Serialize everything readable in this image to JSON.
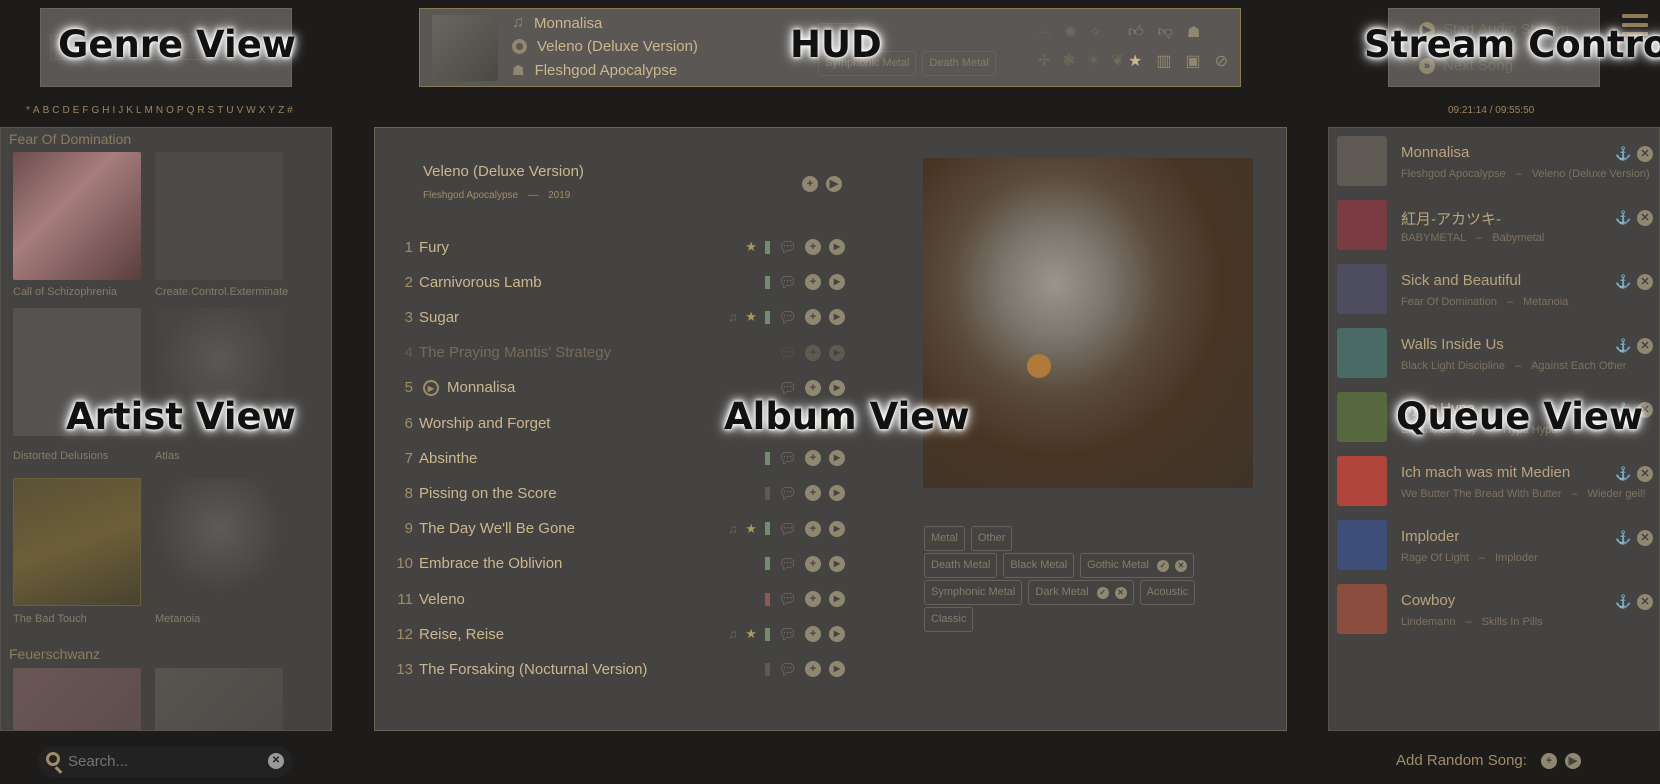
{
  "overlay_labels": {
    "genre": "Genre View",
    "hud": "HUD",
    "stream": "Stream Control",
    "artist": "Artist View",
    "album": "Album View",
    "queue": "Queue View"
  },
  "alphabet": [
    "*",
    "A",
    "B",
    "C",
    "D",
    "E",
    "F",
    "G",
    "H",
    "I",
    "J",
    "K",
    "L",
    "M",
    "N",
    "O",
    "P",
    "Q",
    "R",
    "S",
    "T",
    "U",
    "V",
    "W",
    "X",
    "Y",
    "Z",
    "#"
  ],
  "hud": {
    "song": "Monnalisa",
    "album": "Veleno (Deluxe Version)",
    "artist": "Fleshgod Apocalypse",
    "tags": [
      "Symphonic Metal",
      "Death Metal"
    ],
    "song_icon": "music-note-icon",
    "album_icon": "disc-icon",
    "artist_icon": "people-icon"
  },
  "stream": {
    "start": "Start Audio Stream",
    "next": "Next Song",
    "time": "09:21:14 / 09:55:50"
  },
  "artist_view": {
    "groups": [
      {
        "name": "Fear Of Domination"
      },
      {
        "name": "Feuerschwanz"
      }
    ],
    "albums": [
      {
        "name": "Call of Schizophrenia"
      },
      {
        "name": "Create.Control.Exterminate"
      },
      {
        "name": "Distorted Delusions"
      },
      {
        "name": "Atlas"
      },
      {
        "name": "The Bad Touch"
      },
      {
        "name": "Metanoia"
      }
    ]
  },
  "album_view": {
    "title": "Veleno (Deluxe Version)",
    "artist": "Fleshgod Apocalypse",
    "separator": "—",
    "year": "2019",
    "tracks": [
      {
        "n": "1",
        "t": "Fury",
        "lyrics": false,
        "fav": true,
        "bar": "#6f8f6a",
        "disabled": false
      },
      {
        "n": "2",
        "t": "Carnivorous Lamb",
        "lyrics": false,
        "fav": false,
        "bar": "#6f8f6a",
        "disabled": false
      },
      {
        "n": "3",
        "t": "Sugar",
        "lyrics": true,
        "fav": true,
        "bar": "#6f8f6a",
        "disabled": false
      },
      {
        "n": "4",
        "t": "The Praying Mantis' Strategy",
        "lyrics": false,
        "fav": false,
        "bar": "",
        "disabled": true
      },
      {
        "n": "5",
        "t": "Monnalisa",
        "lyrics": false,
        "fav": false,
        "bar": "",
        "disabled": false,
        "playing": true
      },
      {
        "n": "6",
        "t": "Worship and Forget",
        "lyrics": false,
        "fav": false,
        "bar": "#5f5a50",
        "disabled": false
      },
      {
        "n": "7",
        "t": "Absinthe",
        "lyrics": false,
        "fav": false,
        "bar": "#6f8f6a",
        "disabled": false
      },
      {
        "n": "8",
        "t": "Pissing on the Score",
        "lyrics": false,
        "fav": false,
        "bar": "#5f5a50",
        "disabled": false
      },
      {
        "n": "9",
        "t": "The Day We'll Be Gone",
        "lyrics": true,
        "fav": true,
        "bar": "#6f8f6a",
        "disabled": false
      },
      {
        "n": "10",
        "t": "Embrace the Oblivion",
        "lyrics": false,
        "fav": false,
        "bar": "#6f8f6a",
        "disabled": false
      },
      {
        "n": "11",
        "t": "Veleno",
        "lyrics": false,
        "fav": false,
        "bar": "#8c5a4e",
        "disabled": false
      },
      {
        "n": "12",
        "t": "Reise, Reise",
        "lyrics": true,
        "fav": true,
        "bar": "#6f8f6a",
        "disabled": false
      },
      {
        "n": "13",
        "t": "The Forsaking (Nocturnal Version)",
        "lyrics": false,
        "fav": false,
        "bar": "#5f5a50",
        "disabled": false
      }
    ],
    "tags_row1": [
      "Metal",
      "Other"
    ],
    "tags_row2": [
      "Death Metal",
      "Black Metal",
      "Gothic Metal"
    ],
    "tags_row3": [
      "Symphonic Metal",
      "Dark Metal",
      "Acoustic"
    ],
    "tags_row4": [
      "Classic"
    ]
  },
  "queue": [
    {
      "title": "Monnalisa",
      "artist": "Fleshgod Apocalypse",
      "album": "Veleno (Deluxe Version)",
      "color": "#5e5a53"
    },
    {
      "title": "紅月-アカツキ-",
      "artist": "BABYMETAL",
      "album": "Babymetal",
      "color": "#7a3c42"
    },
    {
      "title": "Sick and Beautiful",
      "artist": "Fear Of Domination",
      "album": "Metanoia",
      "color": "#4e4d60"
    },
    {
      "title": "Walls Inside Us",
      "artist": "Black Light Discipline",
      "album": "Against Each Other",
      "color": "#4a6a66"
    },
    {
      "title": "Hypa Hypa",
      "artist": "Electric Callboy",
      "album": "Hypa Hypa",
      "color": "#56683e"
    },
    {
      "title": "Ich mach was mit Medien",
      "artist": "We Butter The Bread With Butter",
      "album": "Wieder geil!",
      "color": "#b0453c"
    },
    {
      "title": "Imploder",
      "artist": "Rage Of Light",
      "album": "Imploder",
      "color": "#3d4f78"
    },
    {
      "title": "Cowboy",
      "artist": "Lindemann",
      "album": "Skills In Pills",
      "color": "#8a4d3e"
    }
  ],
  "queue_sep": "–",
  "search": {
    "placeholder": "Search..."
  },
  "add_random": {
    "label": "Add Random Song:"
  }
}
